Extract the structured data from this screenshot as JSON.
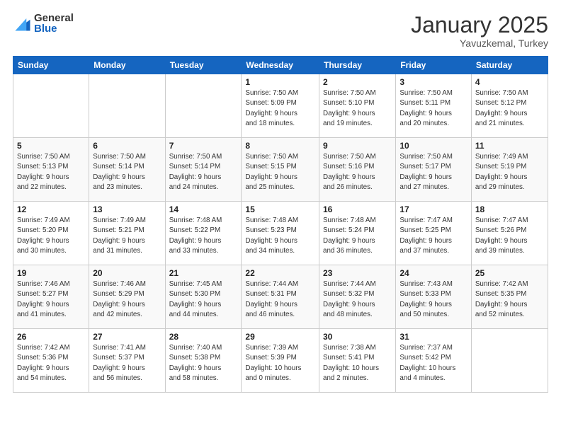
{
  "header": {
    "logo_general": "General",
    "logo_blue": "Blue",
    "month": "January 2025",
    "location": "Yavuzkemal, Turkey"
  },
  "weekdays": [
    "Sunday",
    "Monday",
    "Tuesday",
    "Wednesday",
    "Thursday",
    "Friday",
    "Saturday"
  ],
  "weeks": [
    [
      {
        "day": "",
        "info": ""
      },
      {
        "day": "",
        "info": ""
      },
      {
        "day": "",
        "info": ""
      },
      {
        "day": "1",
        "info": "Sunrise: 7:50 AM\nSunset: 5:09 PM\nDaylight: 9 hours\nand 18 minutes."
      },
      {
        "day": "2",
        "info": "Sunrise: 7:50 AM\nSunset: 5:10 PM\nDaylight: 9 hours\nand 19 minutes."
      },
      {
        "day": "3",
        "info": "Sunrise: 7:50 AM\nSunset: 5:11 PM\nDaylight: 9 hours\nand 20 minutes."
      },
      {
        "day": "4",
        "info": "Sunrise: 7:50 AM\nSunset: 5:12 PM\nDaylight: 9 hours\nand 21 minutes."
      }
    ],
    [
      {
        "day": "5",
        "info": "Sunrise: 7:50 AM\nSunset: 5:13 PM\nDaylight: 9 hours\nand 22 minutes."
      },
      {
        "day": "6",
        "info": "Sunrise: 7:50 AM\nSunset: 5:14 PM\nDaylight: 9 hours\nand 23 minutes."
      },
      {
        "day": "7",
        "info": "Sunrise: 7:50 AM\nSunset: 5:14 PM\nDaylight: 9 hours\nand 24 minutes."
      },
      {
        "day": "8",
        "info": "Sunrise: 7:50 AM\nSunset: 5:15 PM\nDaylight: 9 hours\nand 25 minutes."
      },
      {
        "day": "9",
        "info": "Sunrise: 7:50 AM\nSunset: 5:16 PM\nDaylight: 9 hours\nand 26 minutes."
      },
      {
        "day": "10",
        "info": "Sunrise: 7:50 AM\nSunset: 5:17 PM\nDaylight: 9 hours\nand 27 minutes."
      },
      {
        "day": "11",
        "info": "Sunrise: 7:49 AM\nSunset: 5:19 PM\nDaylight: 9 hours\nand 29 minutes."
      }
    ],
    [
      {
        "day": "12",
        "info": "Sunrise: 7:49 AM\nSunset: 5:20 PM\nDaylight: 9 hours\nand 30 minutes."
      },
      {
        "day": "13",
        "info": "Sunrise: 7:49 AM\nSunset: 5:21 PM\nDaylight: 9 hours\nand 31 minutes."
      },
      {
        "day": "14",
        "info": "Sunrise: 7:48 AM\nSunset: 5:22 PM\nDaylight: 9 hours\nand 33 minutes."
      },
      {
        "day": "15",
        "info": "Sunrise: 7:48 AM\nSunset: 5:23 PM\nDaylight: 9 hours\nand 34 minutes."
      },
      {
        "day": "16",
        "info": "Sunrise: 7:48 AM\nSunset: 5:24 PM\nDaylight: 9 hours\nand 36 minutes."
      },
      {
        "day": "17",
        "info": "Sunrise: 7:47 AM\nSunset: 5:25 PM\nDaylight: 9 hours\nand 37 minutes."
      },
      {
        "day": "18",
        "info": "Sunrise: 7:47 AM\nSunset: 5:26 PM\nDaylight: 9 hours\nand 39 minutes."
      }
    ],
    [
      {
        "day": "19",
        "info": "Sunrise: 7:46 AM\nSunset: 5:27 PM\nDaylight: 9 hours\nand 41 minutes."
      },
      {
        "day": "20",
        "info": "Sunrise: 7:46 AM\nSunset: 5:29 PM\nDaylight: 9 hours\nand 42 minutes."
      },
      {
        "day": "21",
        "info": "Sunrise: 7:45 AM\nSunset: 5:30 PM\nDaylight: 9 hours\nand 44 minutes."
      },
      {
        "day": "22",
        "info": "Sunrise: 7:44 AM\nSunset: 5:31 PM\nDaylight: 9 hours\nand 46 minutes."
      },
      {
        "day": "23",
        "info": "Sunrise: 7:44 AM\nSunset: 5:32 PM\nDaylight: 9 hours\nand 48 minutes."
      },
      {
        "day": "24",
        "info": "Sunrise: 7:43 AM\nSunset: 5:33 PM\nDaylight: 9 hours\nand 50 minutes."
      },
      {
        "day": "25",
        "info": "Sunrise: 7:42 AM\nSunset: 5:35 PM\nDaylight: 9 hours\nand 52 minutes."
      }
    ],
    [
      {
        "day": "26",
        "info": "Sunrise: 7:42 AM\nSunset: 5:36 PM\nDaylight: 9 hours\nand 54 minutes."
      },
      {
        "day": "27",
        "info": "Sunrise: 7:41 AM\nSunset: 5:37 PM\nDaylight: 9 hours\nand 56 minutes."
      },
      {
        "day": "28",
        "info": "Sunrise: 7:40 AM\nSunset: 5:38 PM\nDaylight: 9 hours\nand 58 minutes."
      },
      {
        "day": "29",
        "info": "Sunrise: 7:39 AM\nSunset: 5:39 PM\nDaylight: 10 hours\nand 0 minutes."
      },
      {
        "day": "30",
        "info": "Sunrise: 7:38 AM\nSunset: 5:41 PM\nDaylight: 10 hours\nand 2 minutes."
      },
      {
        "day": "31",
        "info": "Sunrise: 7:37 AM\nSunset: 5:42 PM\nDaylight: 10 hours\nand 4 minutes."
      },
      {
        "day": "",
        "info": ""
      }
    ]
  ]
}
